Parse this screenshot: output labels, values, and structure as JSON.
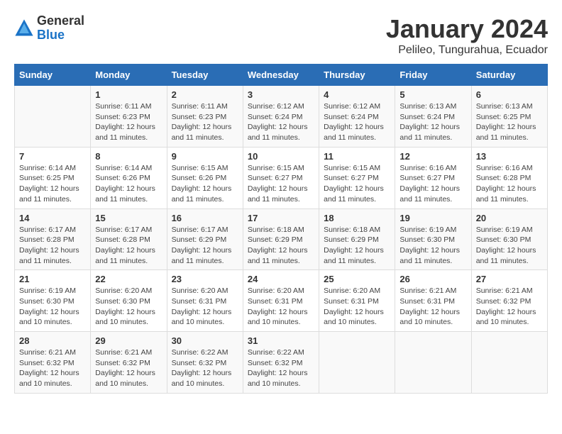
{
  "logo": {
    "general": "General",
    "blue": "Blue"
  },
  "header": {
    "month": "January 2024",
    "location": "Pelileo, Tungurahua, Ecuador"
  },
  "days_of_week": [
    "Sunday",
    "Monday",
    "Tuesday",
    "Wednesday",
    "Thursday",
    "Friday",
    "Saturday"
  ],
  "weeks": [
    [
      {
        "day": "",
        "info": ""
      },
      {
        "day": "1",
        "info": "Sunrise: 6:11 AM\nSunset: 6:23 PM\nDaylight: 12 hours\nand 11 minutes."
      },
      {
        "day": "2",
        "info": "Sunrise: 6:11 AM\nSunset: 6:23 PM\nDaylight: 12 hours\nand 11 minutes."
      },
      {
        "day": "3",
        "info": "Sunrise: 6:12 AM\nSunset: 6:24 PM\nDaylight: 12 hours\nand 11 minutes."
      },
      {
        "day": "4",
        "info": "Sunrise: 6:12 AM\nSunset: 6:24 PM\nDaylight: 12 hours\nand 11 minutes."
      },
      {
        "day": "5",
        "info": "Sunrise: 6:13 AM\nSunset: 6:24 PM\nDaylight: 12 hours\nand 11 minutes."
      },
      {
        "day": "6",
        "info": "Sunrise: 6:13 AM\nSunset: 6:25 PM\nDaylight: 12 hours\nand 11 minutes."
      }
    ],
    [
      {
        "day": "7",
        "info": "Sunrise: 6:14 AM\nSunset: 6:25 PM\nDaylight: 12 hours\nand 11 minutes."
      },
      {
        "day": "8",
        "info": "Sunrise: 6:14 AM\nSunset: 6:26 PM\nDaylight: 12 hours\nand 11 minutes."
      },
      {
        "day": "9",
        "info": "Sunrise: 6:15 AM\nSunset: 6:26 PM\nDaylight: 12 hours\nand 11 minutes."
      },
      {
        "day": "10",
        "info": "Sunrise: 6:15 AM\nSunset: 6:27 PM\nDaylight: 12 hours\nand 11 minutes."
      },
      {
        "day": "11",
        "info": "Sunrise: 6:15 AM\nSunset: 6:27 PM\nDaylight: 12 hours\nand 11 minutes."
      },
      {
        "day": "12",
        "info": "Sunrise: 6:16 AM\nSunset: 6:27 PM\nDaylight: 12 hours\nand 11 minutes."
      },
      {
        "day": "13",
        "info": "Sunrise: 6:16 AM\nSunset: 6:28 PM\nDaylight: 12 hours\nand 11 minutes."
      }
    ],
    [
      {
        "day": "14",
        "info": "Sunrise: 6:17 AM\nSunset: 6:28 PM\nDaylight: 12 hours\nand 11 minutes."
      },
      {
        "day": "15",
        "info": "Sunrise: 6:17 AM\nSunset: 6:28 PM\nDaylight: 12 hours\nand 11 minutes."
      },
      {
        "day": "16",
        "info": "Sunrise: 6:17 AM\nSunset: 6:29 PM\nDaylight: 12 hours\nand 11 minutes."
      },
      {
        "day": "17",
        "info": "Sunrise: 6:18 AM\nSunset: 6:29 PM\nDaylight: 12 hours\nand 11 minutes."
      },
      {
        "day": "18",
        "info": "Sunrise: 6:18 AM\nSunset: 6:29 PM\nDaylight: 12 hours\nand 11 minutes."
      },
      {
        "day": "19",
        "info": "Sunrise: 6:19 AM\nSunset: 6:30 PM\nDaylight: 12 hours\nand 11 minutes."
      },
      {
        "day": "20",
        "info": "Sunrise: 6:19 AM\nSunset: 6:30 PM\nDaylight: 12 hours\nand 11 minutes."
      }
    ],
    [
      {
        "day": "21",
        "info": "Sunrise: 6:19 AM\nSunset: 6:30 PM\nDaylight: 12 hours\nand 10 minutes."
      },
      {
        "day": "22",
        "info": "Sunrise: 6:20 AM\nSunset: 6:30 PM\nDaylight: 12 hours\nand 10 minutes."
      },
      {
        "day": "23",
        "info": "Sunrise: 6:20 AM\nSunset: 6:31 PM\nDaylight: 12 hours\nand 10 minutes."
      },
      {
        "day": "24",
        "info": "Sunrise: 6:20 AM\nSunset: 6:31 PM\nDaylight: 12 hours\nand 10 minutes."
      },
      {
        "day": "25",
        "info": "Sunrise: 6:20 AM\nSunset: 6:31 PM\nDaylight: 12 hours\nand 10 minutes."
      },
      {
        "day": "26",
        "info": "Sunrise: 6:21 AM\nSunset: 6:31 PM\nDaylight: 12 hours\nand 10 minutes."
      },
      {
        "day": "27",
        "info": "Sunrise: 6:21 AM\nSunset: 6:32 PM\nDaylight: 12 hours\nand 10 minutes."
      }
    ],
    [
      {
        "day": "28",
        "info": "Sunrise: 6:21 AM\nSunset: 6:32 PM\nDaylight: 12 hours\nand 10 minutes."
      },
      {
        "day": "29",
        "info": "Sunrise: 6:21 AM\nSunset: 6:32 PM\nDaylight: 12 hours\nand 10 minutes."
      },
      {
        "day": "30",
        "info": "Sunrise: 6:22 AM\nSunset: 6:32 PM\nDaylight: 12 hours\nand 10 minutes."
      },
      {
        "day": "31",
        "info": "Sunrise: 6:22 AM\nSunset: 6:32 PM\nDaylight: 12 hours\nand 10 minutes."
      },
      {
        "day": "",
        "info": ""
      },
      {
        "day": "",
        "info": ""
      },
      {
        "day": "",
        "info": ""
      }
    ]
  ]
}
